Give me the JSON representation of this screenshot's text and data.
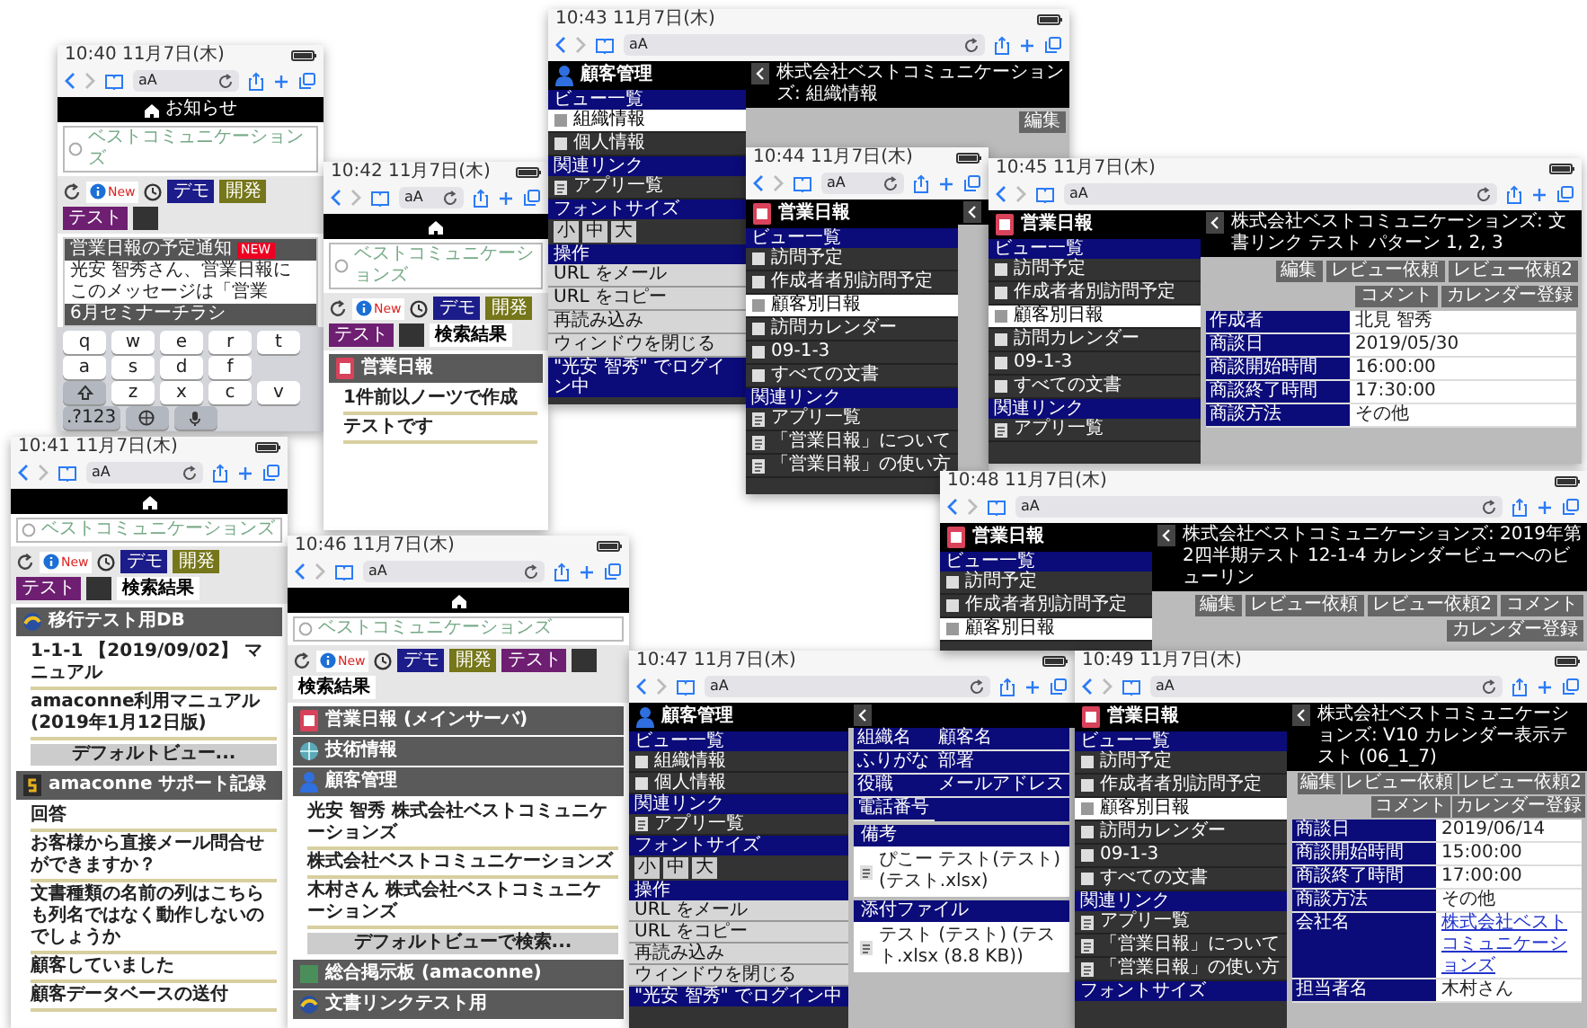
{
  "windows": [
    {
      "kind": "notice",
      "status": "10:40 11月7日(木)",
      "address": "aA",
      "header": "お知らせ",
      "search": "ベストコミュニケーションズ",
      "info_badge": "New",
      "tabs": [
        {
          "label": "デモ",
          "color": "#1c1c8a"
        },
        {
          "label": "開発",
          "color": "#76761a"
        },
        {
          "label": "テスト",
          "color": "#6e1f72"
        }
      ],
      "notice": {
        "title": "営業日報の予定通知",
        "badge": "NEW",
        "lines": [
          "光安 智秀さん、営業日報に",
          "このメッセージは「営業"
        ],
        "next": "6月セミナーチラシ"
      },
      "keyboard": [
        [
          {
            "kind": "char",
            "label": "q"
          },
          {
            "kind": "char",
            "label": "w"
          },
          {
            "kind": "char",
            "label": "e"
          },
          {
            "kind": "char",
            "label": "r"
          },
          {
            "kind": "char",
            "label": "t"
          }
        ],
        [
          {
            "kind": "char",
            "label": "a"
          },
          {
            "kind": "char",
            "label": "s"
          },
          {
            "kind": "char",
            "label": "d"
          },
          {
            "kind": "char",
            "label": "f"
          }
        ],
        [
          {
            "kind": "shift"
          },
          {
            "kind": "char",
            "label": "z"
          },
          {
            "kind": "char",
            "label": "x"
          },
          {
            "kind": "char",
            "label": "c"
          },
          {
            "kind": "char",
            "label": "v"
          }
        ],
        [
          {
            "kind": "char",
            "label": ".?123"
          },
          {
            "kind": "globe"
          },
          {
            "kind": "mic"
          }
        ]
      ]
    },
    {
      "kind": "results",
      "status": "10:41 11月7日(木)",
      "address": "aA",
      "search": "ベストコミュニケーションズ",
      "info_badge": "New",
      "tabs": [
        {
          "label": "デモ",
          "color": "#1c1c8a"
        },
        {
          "label": "開発",
          "color": "#76761a"
        },
        {
          "label": "テスト",
          "color": "#6e1f72"
        }
      ],
      "results_tab": "検索結果",
      "groups": [
        {
          "kind": "doclink",
          "title": "移行テスト用DB",
          "items": [
            "1-1-1 【2019/09/02】 マニュアル",
            "amaconne利用マニュアル (2019年1月12日版)"
          ],
          "more": "デフォルトビュー..."
        },
        {
          "kind": "manual",
          "title": "amaconne サポート記録",
          "items": [
            "回答",
            "お客様から直接メール問合せができますか？",
            "文書種類の名前の列はこちらも列名ではなく動作しないのでしょうか",
            "顧客していました",
            "顧客データベースの送付"
          ]
        }
      ]
    },
    {
      "kind": "results",
      "status": "10:42 11月7日(木)",
      "address": "aA",
      "search": "ベストコミュニケーションズ",
      "info_badge": "New",
      "tabs": [
        {
          "label": "デモ",
          "color": "#1c1c8a"
        },
        {
          "label": "開発",
          "color": "#76761a"
        },
        {
          "label": "テスト",
          "color": "#6e1f72"
        }
      ],
      "results_tab": "検索結果",
      "groups": [
        {
          "kind": "nippo",
          "title": "営業日報",
          "items": [
            "1件前以ノーツで作成",
            "テストです"
          ]
        }
      ]
    },
    {
      "kind": "customer_record",
      "status": "10:43 11月7日(木)",
      "address": "aA",
      "sidebar": {
        "title": "顧客管理",
        "items": [
          {
            "kind": "heading",
            "label": "ビュー一覧"
          },
          {
            "kind": "view",
            "label": "組織情報",
            "selected": true
          },
          {
            "kind": "view",
            "label": "個人情報",
            "selected": false
          },
          {
            "kind": "heading",
            "label": "関連リンク"
          },
          {
            "kind": "link",
            "label": "アプリ一覧"
          },
          {
            "kind": "heading",
            "label": "フォントサイズ"
          },
          {
            "kind": "fontsize",
            "sizes": [
              "小",
              "中",
              "大"
            ]
          },
          {
            "kind": "heading",
            "label": "操作"
          },
          {
            "kind": "action",
            "label": "URL をメール"
          },
          {
            "kind": "action",
            "label": "URL をコピー"
          },
          {
            "kind": "action",
            "label": "再読み込み"
          },
          {
            "kind": "action",
            "label": "ウィンドウを閉じる"
          },
          {
            "kind": "user",
            "label": "\"光安 智秀\" でログイン中"
          }
        ]
      },
      "title": "株式会社ベストコミュニケーションズ: 組織情報",
      "buttons": [
        "編集"
      ]
    },
    {
      "kind": "nippo_record",
      "status": "10:44 11月7日(木)",
      "address": "aA",
      "sidebar": {
        "title": "営業日報",
        "items": [
          {
            "kind": "heading",
            "label": "ビュー一覧"
          },
          {
            "kind": "view",
            "label": "訪問予定",
            "selected": false
          },
          {
            "kind": "view",
            "label": "作成者者別訪問予定",
            "selected": false
          },
          {
            "kind": "view",
            "label": "顧客別日報",
            "selected": true
          },
          {
            "kind": "view",
            "label": "訪問カレンダー",
            "selected": false
          },
          {
            "kind": "view",
            "label": "09-1-3",
            "selected": false
          },
          {
            "kind": "view",
            "label": "すべての文書",
            "selected": false
          },
          {
            "kind": "heading",
            "label": "関連リンク"
          },
          {
            "kind": "link",
            "label": "アプリ一覧"
          },
          {
            "kind": "link",
            "label": "「営業日報」について"
          },
          {
            "kind": "link",
            "label": "「営業日報」の使い方"
          }
        ]
      }
    },
    {
      "kind": "nippo_record",
      "status": "10:45 11月7日(木)",
      "address": "aA",
      "sidebar": {
        "title": "営業日報",
        "items": [
          {
            "kind": "heading",
            "label": "ビュー一覧"
          },
          {
            "kind": "view",
            "label": "訪問予定",
            "selected": false
          },
          {
            "kind": "view",
            "label": "作成者者別訪問予定",
            "selected": false
          },
          {
            "kind": "view",
            "label": "顧客別日報",
            "selected": true
          },
          {
            "kind": "view",
            "label": "訪問カレンダー",
            "selected": false
          },
          {
            "kind": "view",
            "label": "09-1-3",
            "selected": false
          },
          {
            "kind": "view",
            "label": "すべての文書",
            "selected": false
          },
          {
            "kind": "heading",
            "label": "関連リンク"
          },
          {
            "kind": "link",
            "label": "アプリ一覧"
          }
        ]
      },
      "title": "株式会社ベストコミュニケーションズ: 文書リンク テスト パターン 1, 2, 3",
      "buttons": [
        "編集",
        "レビュー依頼",
        "レビュー依頼2",
        "コメント",
        "カレンダー登録"
      ],
      "fields": [
        {
          "label": "作成者",
          "value": "北見 智秀",
          "kind": "text"
        },
        {
          "label": "商談日",
          "value": "2019/05/30",
          "kind": "text"
        },
        {
          "label": "商談開始時間",
          "value": "16:00:00",
          "kind": "text"
        },
        {
          "label": "商談終了時間",
          "value": "17:30:00",
          "kind": "text"
        },
        {
          "label": "商談方法",
          "value": "その他",
          "kind": "text"
        }
      ]
    },
    {
      "kind": "results",
      "status": "10:46 11月7日(木)",
      "address": "aA",
      "search": "ベストコミュニケーションズ",
      "info_badge": "New",
      "tabs": [
        {
          "label": "デモ",
          "color": "#1c1c8a"
        },
        {
          "label": "開発",
          "color": "#76761a"
        },
        {
          "label": "テスト",
          "color": "#6e1f72"
        }
      ],
      "results_tab": "検索結果",
      "groups": [
        {
          "kind": "nippo",
          "title": "営業日報 (メインサーバ)"
        },
        {
          "kind": "tech",
          "title": "技術情報"
        },
        {
          "kind": "customer",
          "title": "顧客管理",
          "items": [
            "光安 智秀 株式会社ベストコミュニケーションズ",
            "株式会社ベストコミュニケーションズ",
            "木村さん 株式会社ベストコミュニケーションズ"
          ],
          "more": "デフォルトビューで検索..."
        },
        {
          "kind": "board",
          "title": "総合掲示板 (amaconne)"
        },
        {
          "kind": "doclink",
          "title": "文書リンクテスト用"
        }
      ]
    },
    {
      "kind": "customer_record",
      "status": "10:47 11月7日(木)",
      "address": "aA",
      "sidebar": {
        "title": "顧客管理",
        "items": [
          {
            "kind": "heading",
            "label": "ビュー一覧"
          },
          {
            "kind": "view",
            "label": "組織情報",
            "selected": false
          },
          {
            "kind": "view",
            "label": "個人情報",
            "selected": false
          },
          {
            "kind": "heading",
            "label": "関連リンク"
          },
          {
            "kind": "link",
            "label": "アプリ一覧"
          },
          {
            "kind": "heading",
            "label": "フォントサイズ"
          },
          {
            "kind": "fontsize",
            "sizes": [
              "小",
              "中",
              "大"
            ]
          },
          {
            "kind": "heading",
            "label": "操作"
          },
          {
            "kind": "action",
            "label": "URL をメール"
          },
          {
            "kind": "action",
            "label": "URL をコピー"
          },
          {
            "kind": "action",
            "label": "再読み込み"
          },
          {
            "kind": "action",
            "label": "ウィンドウを閉じる"
          },
          {
            "kind": "user",
            "label": "\"光安 智秀\" でログイン中"
          }
        ]
      },
      "fields": [
        {
          "label": "組織名"
        },
        {
          "label": "顧客名"
        },
        {
          "label": "ふりがな"
        },
        {
          "label": "部署"
        },
        {
          "label": "役職"
        },
        {
          "label": "メールアドレス"
        },
        {
          "label": "電話番号"
        }
      ],
      "sections": [
        {
          "heading": "備考",
          "text": "ぴこー テスト(テスト) (テスト.xlsx)"
        },
        {
          "heading": "添付ファイル",
          "text": "テスト (テスト) (テスト.xlsx (8.8 KB))"
        }
      ]
    },
    {
      "kind": "nippo_record",
      "status": "10:48 11月7日(木)",
      "address": "aA",
      "sidebar": {
        "title": "営業日報",
        "items": [
          {
            "kind": "heading",
            "label": "ビュー一覧"
          },
          {
            "kind": "view",
            "label": "訪問予定",
            "selected": false
          },
          {
            "kind": "view",
            "label": "作成者者別訪問予定",
            "selected": false
          },
          {
            "kind": "view",
            "label": "顧客別日報",
            "selected": true
          }
        ]
      },
      "title": "株式会社ベストコミュニケーションズ: 2019年第2四半期テスト 12-1-4 カレンダービューへのビューリン",
      "buttons": [
        "編集",
        "レビュー依頼",
        "レビュー依頼2",
        "コメント",
        "カレンダー登録"
      ]
    },
    {
      "kind": "nippo_record",
      "status": "10:49 11月7日(木)",
      "address": "aA",
      "sidebar": {
        "title": "営業日報",
        "items": [
          {
            "kind": "heading",
            "label": "ビュー一覧"
          },
          {
            "kind": "view",
            "label": "訪問予定",
            "selected": false
          },
          {
            "kind": "view",
            "label": "作成者者別訪問予定",
            "selected": false
          },
          {
            "kind": "view",
            "label": "顧客別日報",
            "selected": true
          },
          {
            "kind": "view",
            "label": "訪問カレンダー",
            "selected": false
          },
          {
            "kind": "view",
            "label": "09-1-3",
            "selected": false
          },
          {
            "kind": "view",
            "label": "すべての文書",
            "selected": false
          },
          {
            "kind": "heading",
            "label": "関連リンク"
          },
          {
            "kind": "link",
            "label": "アプリ一覧"
          },
          {
            "kind": "link",
            "label": "「営業日報」について"
          },
          {
            "kind": "link",
            "label": "「営業日報」の使い方"
          },
          {
            "kind": "heading",
            "label": "フォントサイズ"
          }
        ]
      },
      "title": "株式会社ベストコミュニケーションズ: V10 カレンダー表示テスト (06_1_7)",
      "buttons": [
        "編集",
        "レビュー依頼",
        "レビュー依頼2",
        "コメント",
        "カレンダー登録"
      ],
      "fields": [
        {
          "label": "商談日",
          "value": "2019/06/14",
          "kind": "text"
        },
        {
          "label": "商談開始時間",
          "value": "15:00:00",
          "kind": "text"
        },
        {
          "label": "商談終了時間",
          "value": "17:00:00",
          "kind": "text"
        },
        {
          "label": "商談方法",
          "value": "その他",
          "kind": "text"
        },
        {
          "label": "会社名",
          "value": "株式会社ベストコミュニケーションズ",
          "kind": "link"
        },
        {
          "label": "担当者名",
          "value": "木村さん",
          "kind": "text"
        }
      ]
    }
  ]
}
